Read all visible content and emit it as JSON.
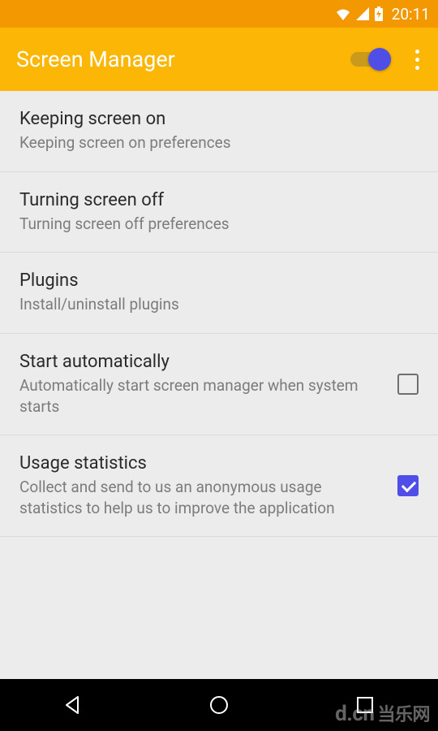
{
  "status": {
    "time": "20:11"
  },
  "appbar": {
    "title": "Screen Manager",
    "toggle_on": true
  },
  "items": [
    {
      "title": "Keeping screen on",
      "sub": "Keeping screen on preferences",
      "checkbox": null
    },
    {
      "title": "Turning screen off",
      "sub": "Turning screen off preferences",
      "checkbox": null
    },
    {
      "title": "Plugins",
      "sub": "Install/uninstall plugins",
      "checkbox": null
    },
    {
      "title": "Start automatically",
      "sub": "Automatically start screen manager when system starts",
      "checkbox": false
    },
    {
      "title": "Usage statistics",
      "sub": "Collect and send to us an anonymous usage statistics to help us to improve the application",
      "checkbox": true
    }
  ],
  "watermark": {
    "domain": "d.cn",
    "text": "当乐网"
  },
  "colors": {
    "status_bg": "#f39800",
    "appbar_bg": "#fcb605",
    "accent": "#4f4fe8"
  }
}
